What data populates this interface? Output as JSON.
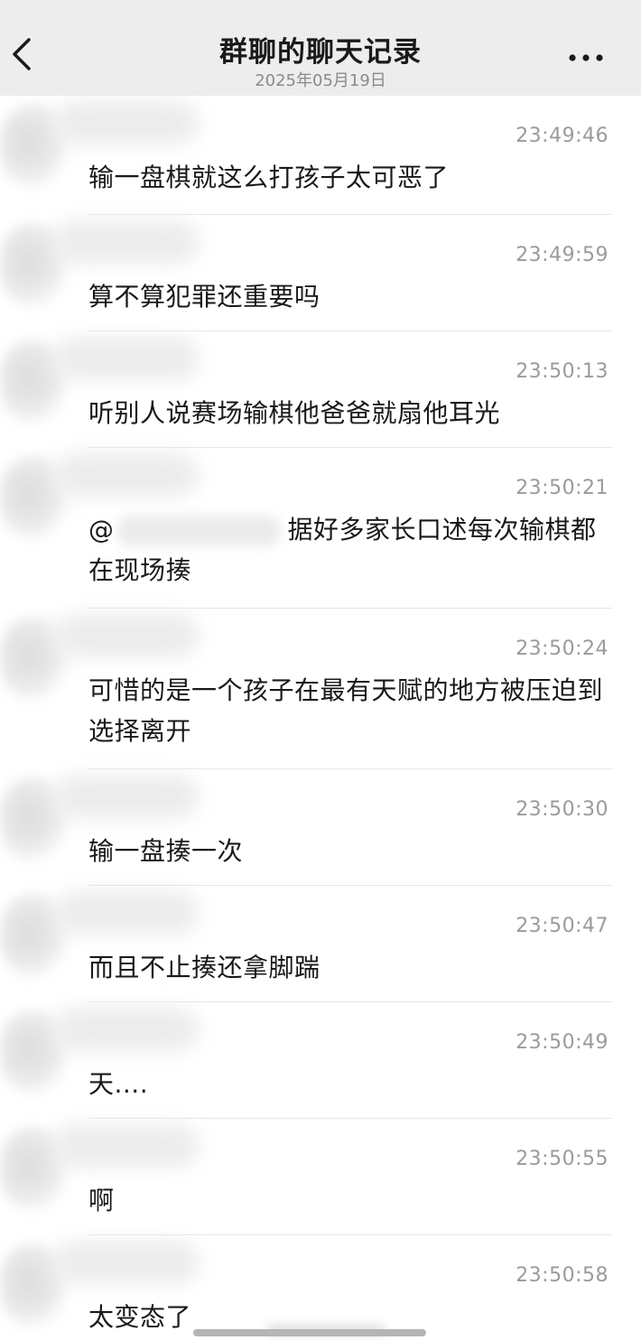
{
  "header": {
    "title": "群聊的聊天记录",
    "date": "2025年05月19日",
    "back_icon": "chevron-left-icon",
    "more_icon": "more-horizontal-icon"
  },
  "messages": [
    {
      "time": "23:49:46",
      "text": "输一盘棋就这么打孩子太可恶了"
    },
    {
      "time": "23:49:59",
      "text": "算不算犯罪还重要吗"
    },
    {
      "time": "23:50:13",
      "text": "听别人说赛场输棋他爸爸就扇他耳光"
    },
    {
      "time": "23:50:21",
      "mention_prefix": "@",
      "text": "据好多家长口述每次输棋都在现场揍"
    },
    {
      "time": "23:50:24",
      "text": "可惜的是一个孩子在最有天赋的地方被压迫到选择离开"
    },
    {
      "time": "23:50:30",
      "text": "输一盘揍一次"
    },
    {
      "time": "23:50:47",
      "text": "而且不止揍还拿脚踹"
    },
    {
      "time": "23:50:49",
      "text": "天...."
    },
    {
      "time": "23:50:55",
      "text": "啊"
    },
    {
      "time": "23:50:58",
      "text": "太变态了"
    }
  ]
}
